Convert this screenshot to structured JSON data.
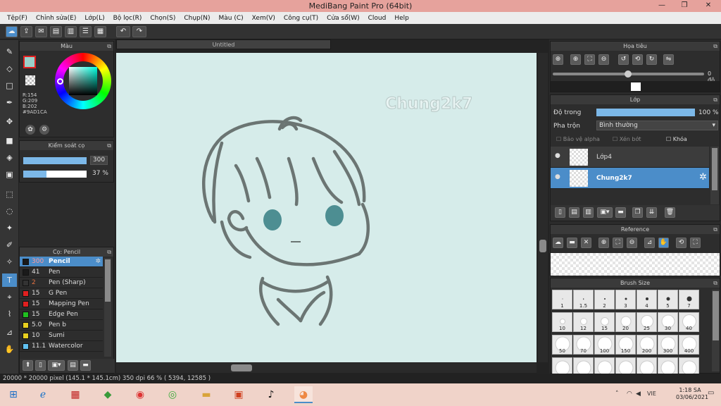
{
  "app": {
    "title": "MediBang Paint Pro (64bit)"
  },
  "menu": [
    "Tệp(F)",
    "Chỉnh sửa(E)",
    "Lớp(L)",
    "Bộ lọc(R)",
    "Chọn(S)",
    "Chụp(N)",
    "Màu (C)",
    "Xem(V)",
    "Công cụ(T)",
    "Cửa sổ(W)",
    "Cloud",
    "Help"
  ],
  "color_panel": {
    "title": "Màu",
    "r": "R:154",
    "g": "G:209",
    "b": "B:202",
    "hex": "#9AD1CA",
    "color": "#9AD1CA"
  },
  "brush_control": {
    "title": "Kiểm soát cọ",
    "size": "300",
    "opacity": "37 %",
    "size_fill": 1.0,
    "opacity_fill": 0.37
  },
  "brush_list": {
    "title": "Cọ: Pencil",
    "items": [
      {
        "size": "300",
        "name": "Pencil",
        "color": "#1a1a1a",
        "selected": true
      },
      {
        "size": "41",
        "name": "Pen",
        "color": "#1a1a1a"
      },
      {
        "size": "2",
        "name": "Pen (Sharp)",
        "color": "#333333"
      },
      {
        "size": "15",
        "name": "G Pen",
        "color": "#e02020"
      },
      {
        "size": "15",
        "name": "Mapping Pen",
        "color": "#e02020"
      },
      {
        "size": "15",
        "name": "Edge Pen",
        "color": "#20c020"
      },
      {
        "size": "5.0",
        "name": "Pen b",
        "color": "#e8d020"
      },
      {
        "size": "10",
        "name": "Sumi",
        "color": "#e8d020"
      },
      {
        "size": "11.1",
        "name": "Watercolor",
        "color": "#60c0f0"
      }
    ]
  },
  "canvas": {
    "tab": "Untitled",
    "watermark": "Chung2k7"
  },
  "navigator": {
    "title": "Họa tiêu",
    "angle": "0 độ"
  },
  "layers": {
    "title": "Lớp",
    "opacity_label": "Độ trong",
    "opacity_value": "100 %",
    "blend_label": "Pha trộn",
    "blend_value": "Bình thường",
    "protect_alpha": "Bảo vệ alpha",
    "clipping": "Xén bớt",
    "lock": "Khóa",
    "items": [
      {
        "name": "Lớp4",
        "selected": false
      },
      {
        "name": "Chung2k7",
        "selected": true
      }
    ]
  },
  "reference": {
    "title": "Reference"
  },
  "brush_size": {
    "title": "Brush Size",
    "sizes": [
      "1",
      "1.5",
      "2",
      "3",
      "4",
      "5",
      "7",
      "10",
      "12",
      "15",
      "20",
      "25",
      "30",
      "40",
      "50",
      "70",
      "100",
      "150",
      "200",
      "300",
      "400"
    ]
  },
  "status": {
    "text": "20000 * 20000 pixel   (145.1 * 145.1cm)   350 dpi   66 %   ( 5394, 12585 )"
  },
  "taskbar": {
    "lang": "VIE",
    "time": "1:18 SA",
    "date": "03/06/2021"
  }
}
